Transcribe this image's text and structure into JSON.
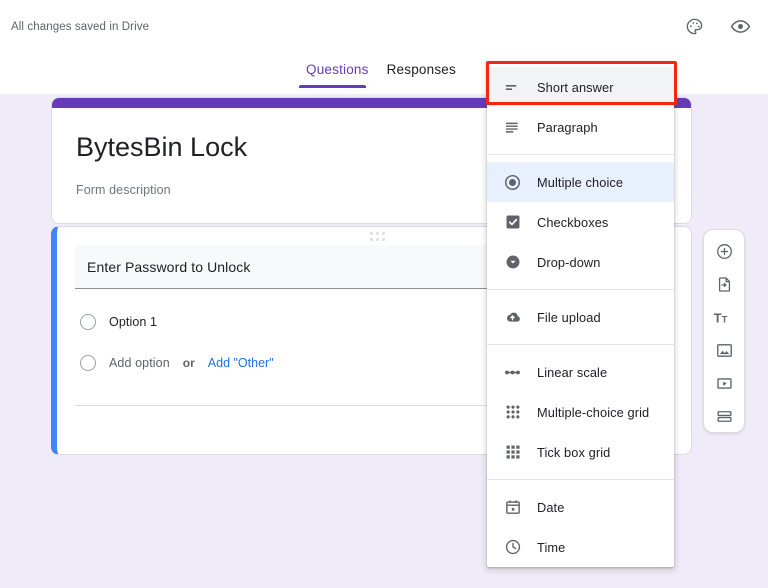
{
  "header": {
    "save_status": "All changes saved in Drive",
    "icons": [
      {
        "name": "palette-icon",
        "label": "Customize theme"
      },
      {
        "name": "eye-icon",
        "label": "Preview"
      }
    ],
    "tabs": [
      {
        "label": "Questions",
        "active": true
      },
      {
        "label": "Responses",
        "active": false
      }
    ]
  },
  "form": {
    "title": "BytesBin Lock",
    "description": "Form description",
    "accent_color": "#673ab7"
  },
  "question": {
    "title": "Enter Password to Unlock",
    "accent_color": "#4285f4",
    "options": [
      {
        "label": "Option 1",
        "type": "radio"
      }
    ],
    "add_option_label": "Add option",
    "or_label": "or",
    "add_other_label": "Add \"Other\"",
    "image_button": "add-image-icon",
    "duplicate_button": "duplicate-icon",
    "drag_handle": "drag-handle-icon"
  },
  "toolbar": {
    "items": [
      {
        "name": "add-question-button",
        "icon": "plus-circle-icon"
      },
      {
        "name": "import-questions-button",
        "icon": "import-icon"
      },
      {
        "name": "add-title-button",
        "icon": "title-text-icon"
      },
      {
        "name": "add-image-button",
        "icon": "image-icon"
      },
      {
        "name": "add-video-button",
        "icon": "video-icon"
      },
      {
        "name": "add-section-button",
        "icon": "section-icon"
      }
    ]
  },
  "menu": {
    "highlight_color": "#f4260e",
    "groups": [
      {
        "items": [
          {
            "label": "Short answer",
            "icon": "short-answer-icon",
            "state": "hover"
          },
          {
            "label": "Paragraph",
            "icon": "paragraph-icon",
            "state": "none"
          }
        ]
      },
      {
        "items": [
          {
            "label": "Multiple choice",
            "icon": "radio-icon",
            "state": "selected"
          },
          {
            "label": "Checkboxes",
            "icon": "checkbox-icon",
            "state": "none"
          },
          {
            "label": "Drop-down",
            "icon": "dropdown-icon",
            "state": "none"
          }
        ]
      },
      {
        "items": [
          {
            "label": "File upload",
            "icon": "file-upload-icon",
            "state": "none"
          }
        ]
      },
      {
        "items": [
          {
            "label": "Linear scale",
            "icon": "linear-scale-icon",
            "state": "none"
          },
          {
            "label": "Multiple-choice grid",
            "icon": "mc-grid-icon",
            "state": "none"
          },
          {
            "label": "Tick box grid",
            "icon": "tick-grid-icon",
            "state": "none"
          }
        ]
      },
      {
        "items": [
          {
            "label": "Date",
            "icon": "calendar-icon",
            "state": "none"
          },
          {
            "label": "Time",
            "icon": "clock-icon",
            "state": "none"
          }
        ]
      }
    ]
  }
}
